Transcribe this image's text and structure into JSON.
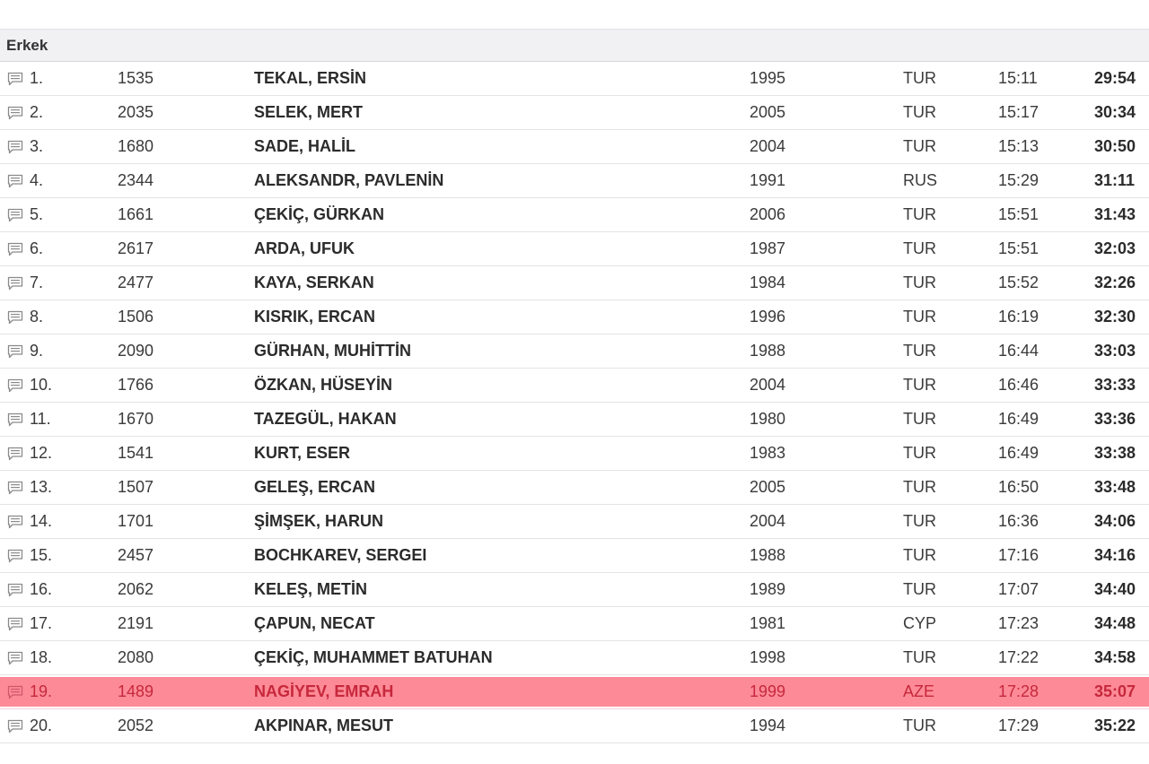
{
  "group": {
    "title": "Erkek"
  },
  "rows": [
    {
      "rank": "1.",
      "bib": "1535",
      "name": "TEKAL, ERSİN",
      "year": "1995",
      "nat": "TUR",
      "split": "15:11",
      "time": "29:54"
    },
    {
      "rank": "2.",
      "bib": "2035",
      "name": "SELEK, MERT",
      "year": "2005",
      "nat": "TUR",
      "split": "15:17",
      "time": "30:34"
    },
    {
      "rank": "3.",
      "bib": "1680",
      "name": "SADE, HALİL",
      "year": "2004",
      "nat": "TUR",
      "split": "15:13",
      "time": "30:50"
    },
    {
      "rank": "4.",
      "bib": "2344",
      "name": "ALEKSANDR, PAVLENİN",
      "year": "1991",
      "nat": "RUS",
      "split": "15:29",
      "time": "31:11"
    },
    {
      "rank": "5.",
      "bib": "1661",
      "name": "ÇEKİÇ, GÜRKAN",
      "year": "2006",
      "nat": "TUR",
      "split": "15:51",
      "time": "31:43"
    },
    {
      "rank": "6.",
      "bib": "2617",
      "name": "ARDA, UFUK",
      "year": "1987",
      "nat": "TUR",
      "split": "15:51",
      "time": "32:03"
    },
    {
      "rank": "7.",
      "bib": "2477",
      "name": "KAYA, SERKAN",
      "year": "1984",
      "nat": "TUR",
      "split": "15:52",
      "time": "32:26"
    },
    {
      "rank": "8.",
      "bib": "1506",
      "name": "KISRIK, ERCAN",
      "year": "1996",
      "nat": "TUR",
      "split": "16:19",
      "time": "32:30"
    },
    {
      "rank": "9.",
      "bib": "2090",
      "name": "GÜRHAN, MUHİTTİN",
      "year": "1988",
      "nat": "TUR",
      "split": "16:44",
      "time": "33:03"
    },
    {
      "rank": "10.",
      "bib": "1766",
      "name": "ÖZKAN, HÜSEYİN",
      "year": "2004",
      "nat": "TUR",
      "split": "16:46",
      "time": "33:33"
    },
    {
      "rank": "11.",
      "bib": "1670",
      "name": "TAZEGÜL, HAKAN",
      "year": "1980",
      "nat": "TUR",
      "split": "16:49",
      "time": "33:36"
    },
    {
      "rank": "12.",
      "bib": "1541",
      "name": "KURT, ESER",
      "year": "1983",
      "nat": "TUR",
      "split": "16:49",
      "time": "33:38"
    },
    {
      "rank": "13.",
      "bib": "1507",
      "name": "GELEŞ, ERCAN",
      "year": "2005",
      "nat": "TUR",
      "split": "16:50",
      "time": "33:48"
    },
    {
      "rank": "14.",
      "bib": "1701",
      "name": "ŞİMŞEK, HARUN",
      "year": "2004",
      "nat": "TUR",
      "split": "16:36",
      "time": "34:06"
    },
    {
      "rank": "15.",
      "bib": "2457",
      "name": "BOCHKAREV, SERGEI",
      "year": "1988",
      "nat": "TUR",
      "split": "17:16",
      "time": "34:16"
    },
    {
      "rank": "16.",
      "bib": "2062",
      "name": "KELEŞ, METİN",
      "year": "1989",
      "nat": "TUR",
      "split": "17:07",
      "time": "34:40"
    },
    {
      "rank": "17.",
      "bib": "2191",
      "name": "ÇAPUN, NECAT",
      "year": "1981",
      "nat": "CYP",
      "split": "17:23",
      "time": "34:48"
    },
    {
      "rank": "18.",
      "bib": "2080",
      "name": "ÇEKİÇ, MUHAMMET BATUHAN",
      "year": "1998",
      "nat": "TUR",
      "split": "17:22",
      "time": "34:58"
    },
    {
      "rank": "19.",
      "bib": "1489",
      "name": "NAGİYEV, EMRAH",
      "year": "1999",
      "nat": "AZE",
      "split": "17:28",
      "time": "35:07",
      "highlighted": true
    },
    {
      "rank": "20.",
      "bib": "2052",
      "name": "AKPINAR, MESUT",
      "year": "1994",
      "nat": "TUR",
      "split": "17:29",
      "time": "35:22"
    }
  ],
  "icons": {
    "row_icon": "comment-icon"
  },
  "colors": {
    "highlight_bg": "#fc8b97",
    "highlight_text": "#c7283c",
    "header_bg": "#f1f1f4"
  }
}
